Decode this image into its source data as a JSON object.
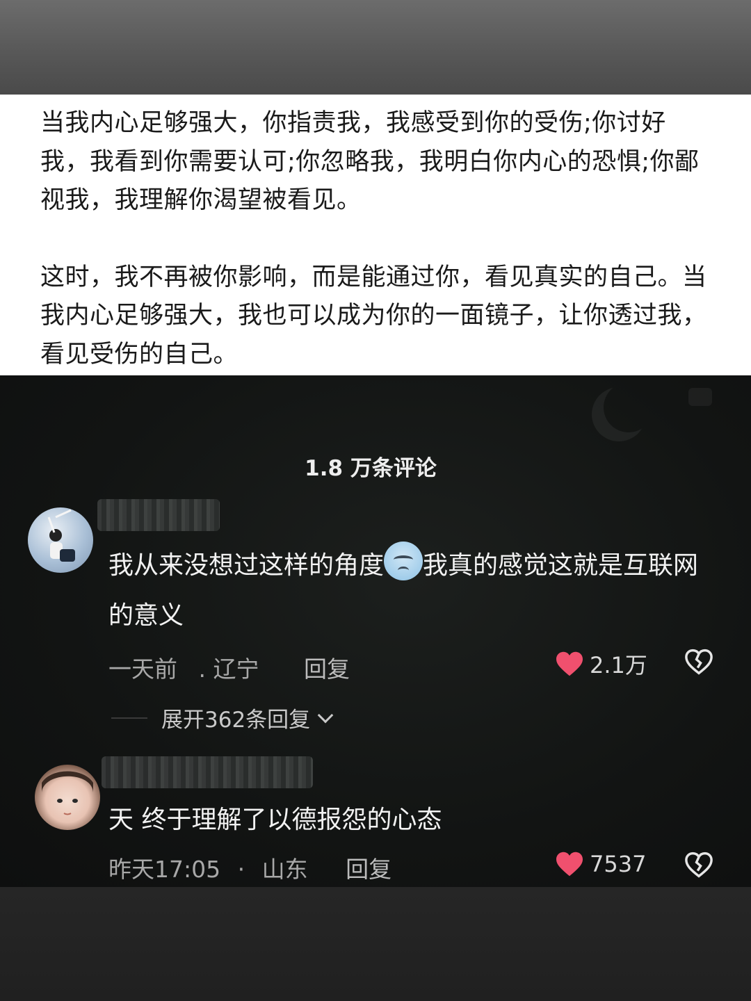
{
  "quote": {
    "paragraph1": "当我内心足够强大，你指责我，我感受到你的受伤;你讨好我，我看到你需要认可;你忽略我，我明白你内心的恐惧;你鄙视我，我理解你渴望被看见。",
    "paragraph2": "这时，我不再被你影响，而是能通过你，看见真实的自己。当我内心足够强大，我也可以成为你的一面镜子，让你透过我，看见受伤的自己。"
  },
  "comments_count": "1.8 万条评论",
  "comments": [
    {
      "text_before_emoji": "我从来没想过这样的角度",
      "emoji": "crying-face-icon",
      "text_after_emoji": "我真的感觉这就是互联网的意义",
      "time": "一天前",
      "location": ". 辽宁",
      "reply_label": "回复",
      "likes": "2.1万",
      "expand_label": "展开362条回复"
    },
    {
      "text": "天 终于理解了以德报怨的心态",
      "time": "昨天17:05",
      "separator": "·",
      "location": "山东",
      "reply_label": "回复",
      "likes": "7537"
    }
  ],
  "colors": {
    "like_heart": "#f0506e",
    "background": "#121212"
  }
}
